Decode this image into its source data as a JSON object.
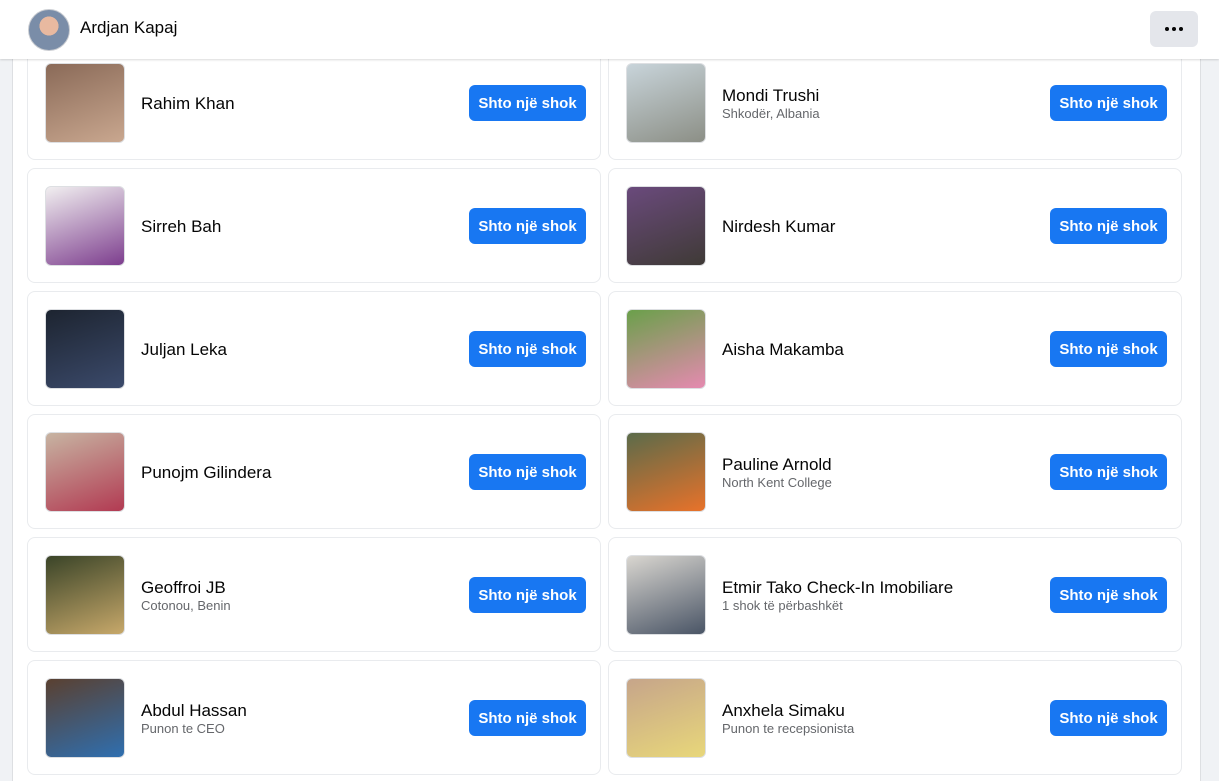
{
  "header": {
    "user_name": "Ardjan Kapaj",
    "more_icon": "more-horizontal-icon"
  },
  "button_color": "#1877f2",
  "people": [
    {
      "name": "Rahim Khan",
      "subtitle": "",
      "button": "Shto një shok",
      "photo_colors": [
        "#8a6a58",
        "#c9a78f"
      ]
    },
    {
      "name": "Mondi Trushi",
      "subtitle": "Shkodër, Albania",
      "button": "Shto një shok",
      "photo_colors": [
        "#c8d4da",
        "#8c8f86"
      ]
    },
    {
      "name": "Sirreh Bah",
      "subtitle": "",
      "button": "Shto një shok",
      "photo_colors": [
        "#f1eff0",
        "#7d3e8e"
      ]
    },
    {
      "name": "Nirdesh Kumar",
      "subtitle": "",
      "button": "Shto një shok",
      "photo_colors": [
        "#6a4a7c",
        "#3f3a36"
      ]
    },
    {
      "name": "Juljan Leka",
      "subtitle": "",
      "button": "Shto një shok",
      "photo_colors": [
        "#1d2430",
        "#3b4a6b"
      ]
    },
    {
      "name": "Aisha Makamba",
      "subtitle": "",
      "button": "Shto një shok",
      "photo_colors": [
        "#6aa04a",
        "#e58ab0"
      ]
    },
    {
      "name": "Punojm Gilindera",
      "subtitle": "",
      "button": "Shto një shok",
      "photo_colors": [
        "#c7b4a2",
        "#b23a52"
      ]
    },
    {
      "name": "Pauline Arnold",
      "subtitle": "North Kent College",
      "button": "Shto një shok",
      "photo_colors": [
        "#5b6b4a",
        "#e8722a"
      ]
    },
    {
      "name": "Geoffroi JB",
      "subtitle": "Cotonou, Benin",
      "button": "Shto një shok",
      "photo_colors": [
        "#3a4428",
        "#c7a86a"
      ]
    },
    {
      "name": "Etmir Tako Check-In Imobiliare",
      "subtitle": "1 shok të përbashkët",
      "button": "Shto një shok",
      "photo_colors": [
        "#d9d6d0",
        "#4a5566"
      ]
    },
    {
      "name": "Abdul Hassan",
      "subtitle": "Punon te CEO",
      "button": "Shto një shok",
      "photo_colors": [
        "#5a4030",
        "#2f6fb0"
      ]
    },
    {
      "name": "Anxhela Simaku",
      "subtitle": "Punon te recepsionista",
      "button": "Shto një shok",
      "photo_colors": [
        "#c6a58a",
        "#e8d77a"
      ]
    }
  ]
}
